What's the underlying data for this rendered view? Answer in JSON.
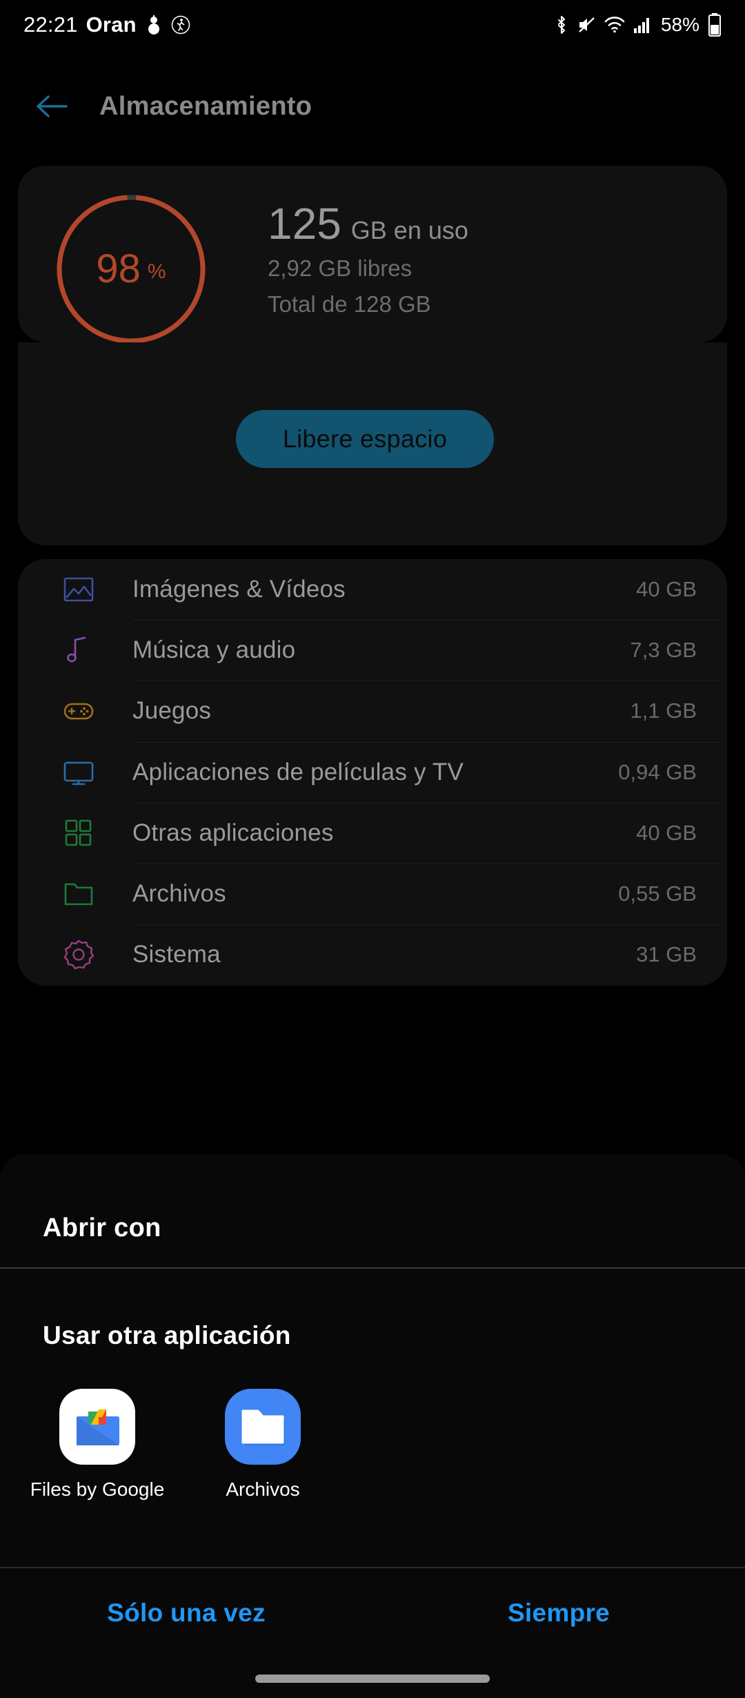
{
  "status_bar": {
    "clock": "22:21",
    "carrier": "Oran",
    "battery_percent": "58%",
    "icons_left": [
      "weather-snowman-icon",
      "activity-walking-icon"
    ],
    "icons_right": [
      "bluetooth-icon",
      "mute-icon",
      "wifi-icon",
      "signal-icon",
      "battery-icon"
    ]
  },
  "action_bar": {
    "back_icon": "arrow-left-icon",
    "title": "Almacenamiento",
    "accent_color": "#1a6f94"
  },
  "storage_summary": {
    "percent_value": "98",
    "percent_unit": "%",
    "percent_number": 98,
    "used_number": "125",
    "used_label": "GB en uso",
    "free_text": "2,92 GB libres",
    "total_text": "Total de 128 GB",
    "gauge_color": "#b4472b",
    "free_space_button": "Libere espacio",
    "free_space_button_color": "#12536f"
  },
  "categories": [
    {
      "icon": "image-icon",
      "label": "Imágenes & Vídeos",
      "size": "40 GB",
      "color": "#3f4fa0"
    },
    {
      "icon": "music-note-icon",
      "label": "Música y audio",
      "size": "7,3 GB",
      "color": "#8a4fa8"
    },
    {
      "icon": "gamepad-icon",
      "label": "Juegos",
      "size": "1,1 GB",
      "color": "#a07018"
    },
    {
      "icon": "tv-icon",
      "label": "Aplicaciones de películas y TV",
      "size": "0,94 GB",
      "color": "#2b6fa8"
    },
    {
      "icon": "apps-grid-icon",
      "label": "Otras aplicaciones",
      "size": "40 GB",
      "color": "#1f7a3a"
    },
    {
      "icon": "folder-icon",
      "label": "Archivos",
      "size": "0,55 GB",
      "color": "#1f7a3a"
    },
    {
      "icon": "gear-icon",
      "label": "Sistema",
      "size": "31 GB",
      "color": "#9a3f82"
    }
  ],
  "open_with_sheet": {
    "title": "Abrir con",
    "subtitle": "Usar otra aplicación",
    "apps": [
      {
        "name": "Files by Google",
        "icon": "files-by-google-icon"
      },
      {
        "name": "Archivos",
        "icon": "archivos-folder-icon"
      }
    ],
    "actions": [
      {
        "label": "Sólo una vez"
      },
      {
        "label": "Siempre"
      }
    ],
    "action_color": "#2196f3"
  }
}
